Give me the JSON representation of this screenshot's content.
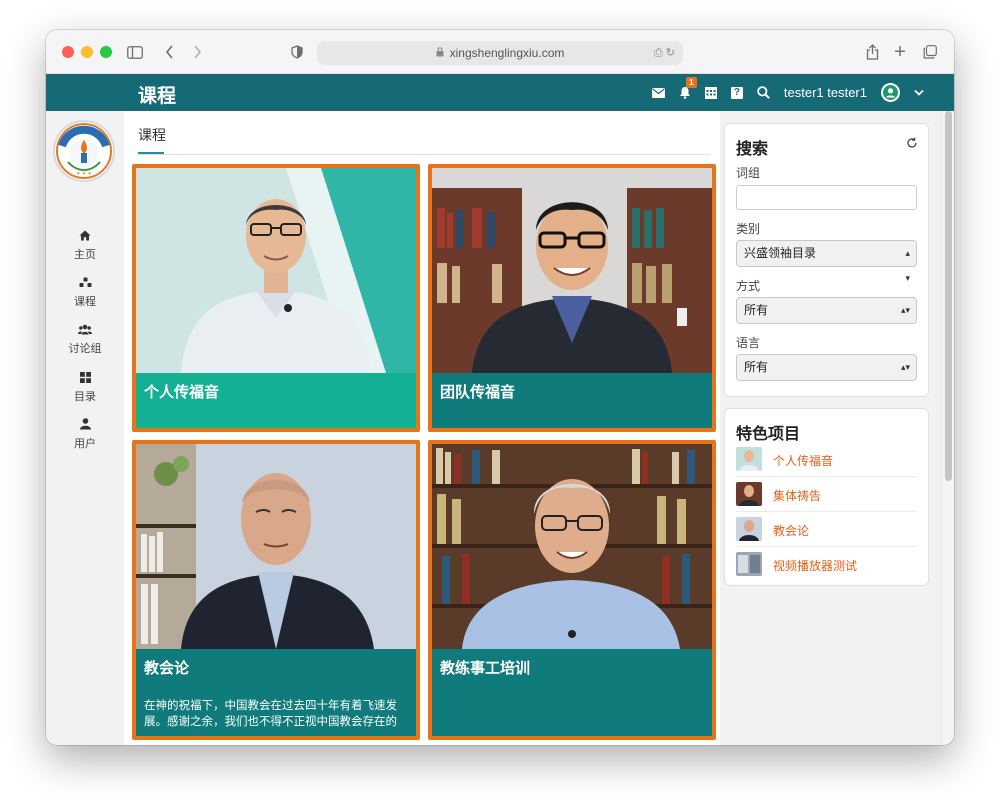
{
  "browser": {
    "url": "xingshenglingxiu.com"
  },
  "app": {
    "title": "课程",
    "notification_count": "1",
    "help_icon": "?",
    "username": "tester1 tester1"
  },
  "nav": {
    "items": [
      {
        "label": "主页",
        "icon": "home-icon"
      },
      {
        "label": "课程",
        "icon": "courses-icon"
      },
      {
        "label": "讨论组",
        "icon": "group-icon"
      },
      {
        "label": "目录",
        "icon": "catalog-icon"
      },
      {
        "label": "用户",
        "icon": "user-icon"
      }
    ]
  },
  "main": {
    "tab": "课程",
    "cards": [
      {
        "title": "个人传福音"
      },
      {
        "title": "团队传福音"
      },
      {
        "title": "教会论",
        "description": "在神的祝福下，中国教会在过去四十年有着飞速发展。感谢之余，我们也不得不正视中国教会存在的"
      },
      {
        "title": "教练事工培训"
      }
    ]
  },
  "search": {
    "title": "搜索",
    "term_label": "词组",
    "term_value": "",
    "category_label": "类别",
    "category_value": "兴盛领袖目录",
    "mode_label": "方式",
    "mode_value": "所有",
    "language_label": "语言",
    "language_value": "所有"
  },
  "featured": {
    "title": "特色项目",
    "items": [
      "个人传福音",
      "集体祷告",
      "教会论",
      "视频播放器测试"
    ]
  },
  "colors": {
    "header": "#166a76",
    "card_border": "#e8741a",
    "caption_teal": "#0f7b7b",
    "link_orange": "#e0621b"
  }
}
